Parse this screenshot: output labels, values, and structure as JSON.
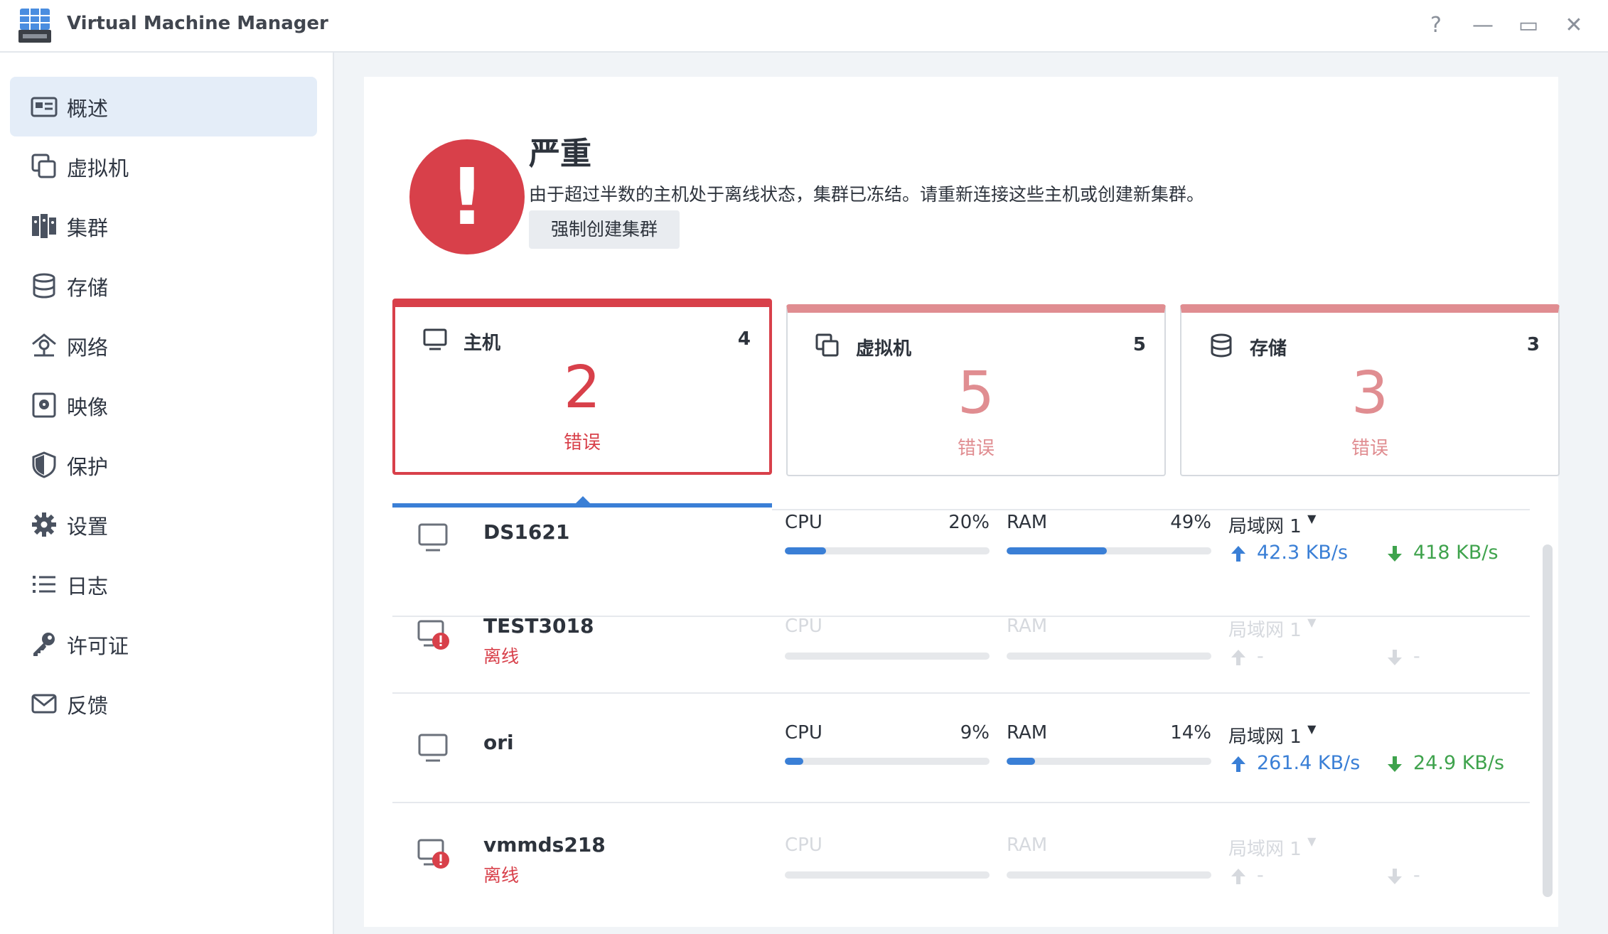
{
  "window": {
    "title": "Virtual Machine Manager",
    "help": "?",
    "minimize": "—",
    "maximize": "▭",
    "close": "✕"
  },
  "sidebar": {
    "items": [
      {
        "label": "概述",
        "icon": "overview-icon",
        "active": true
      },
      {
        "label": "虚拟机",
        "icon": "virtual-machine-icon"
      },
      {
        "label": "集群",
        "icon": "cluster-icon"
      },
      {
        "label": "存储",
        "icon": "storage-icon"
      },
      {
        "label": "网络",
        "icon": "network-icon"
      },
      {
        "label": "映像",
        "icon": "image-icon"
      },
      {
        "label": "保护",
        "icon": "shield-icon"
      },
      {
        "label": "设置",
        "icon": "gear-icon"
      },
      {
        "label": "日志",
        "icon": "log-list-icon"
      },
      {
        "label": "许可证",
        "icon": "key-icon"
      },
      {
        "label": "反馈",
        "icon": "mail-icon"
      }
    ]
  },
  "alert": {
    "symbol": "!",
    "title": "严重",
    "description": "由于超过半数的主机处于离线状态，集群已冻结。请重新连接这些主机或创建新集群。",
    "button": "强制创建集群"
  },
  "cards": [
    {
      "title": "主机",
      "count": "4",
      "big": "2",
      "status": "错误",
      "selected": true
    },
    {
      "title": "虚拟机",
      "count": "5",
      "big": "5",
      "status": "错误"
    },
    {
      "title": "存储",
      "count": "3",
      "big": "3",
      "status": "错误"
    }
  ],
  "hosts": [
    {
      "name": "DS1621",
      "status": "",
      "online": true,
      "cpu_label": "CPU",
      "cpu": "20%",
      "cpu_frac": 0.2,
      "ram_label": "RAM",
      "ram": "49%",
      "ram_frac": 0.49,
      "lan": "局域网 1",
      "up": "42.3 KB/s",
      "down": "418 KB/s"
    },
    {
      "name": "TEST3018",
      "status": "离线",
      "online": false,
      "cpu_label": "CPU",
      "cpu": "",
      "cpu_frac": 0,
      "ram_label": "RAM",
      "ram": "",
      "ram_frac": 0,
      "lan": "局域网 1",
      "up": "-",
      "down": "-"
    },
    {
      "name": "ori",
      "status": "",
      "online": true,
      "cpu_label": "CPU",
      "cpu": "9%",
      "cpu_frac": 0.09,
      "ram_label": "RAM",
      "ram": "14%",
      "ram_frac": 0.14,
      "lan": "局域网 1",
      "up": "261.4 KB/s",
      "down": "24.9 KB/s"
    },
    {
      "name": "vmmds218",
      "status": "离线",
      "online": false,
      "cpu_label": "CPU",
      "cpu": "",
      "cpu_frac": 0,
      "ram_label": "RAM",
      "ram": "",
      "ram_frac": 0,
      "lan": "局域网 1",
      "up": "-",
      "down": "-"
    }
  ],
  "colors": {
    "accent": "#3a7fd6",
    "error": "#d8404a",
    "error_light": "#e08d91",
    "upload": "#3a7fd6",
    "download": "#3fa34d"
  }
}
